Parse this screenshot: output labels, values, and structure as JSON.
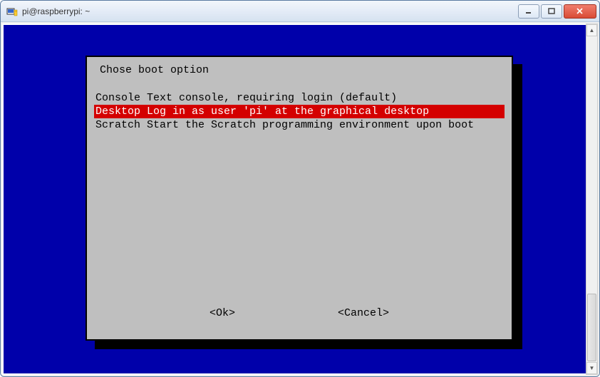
{
  "window": {
    "title": "pi@raspberrypi: ~"
  },
  "dialog": {
    "title": "Chose boot option",
    "items": [
      {
        "text": "Console Text console, requiring login (default)",
        "selected": false
      },
      {
        "text": "Desktop Log in as user 'pi' at the graphical desktop   ",
        "selected": true
      },
      {
        "text": "Scratch Start the Scratch programming environment upon boot",
        "selected": false
      }
    ],
    "ok_label": "<Ok>",
    "cancel_label": "<Cancel>"
  }
}
